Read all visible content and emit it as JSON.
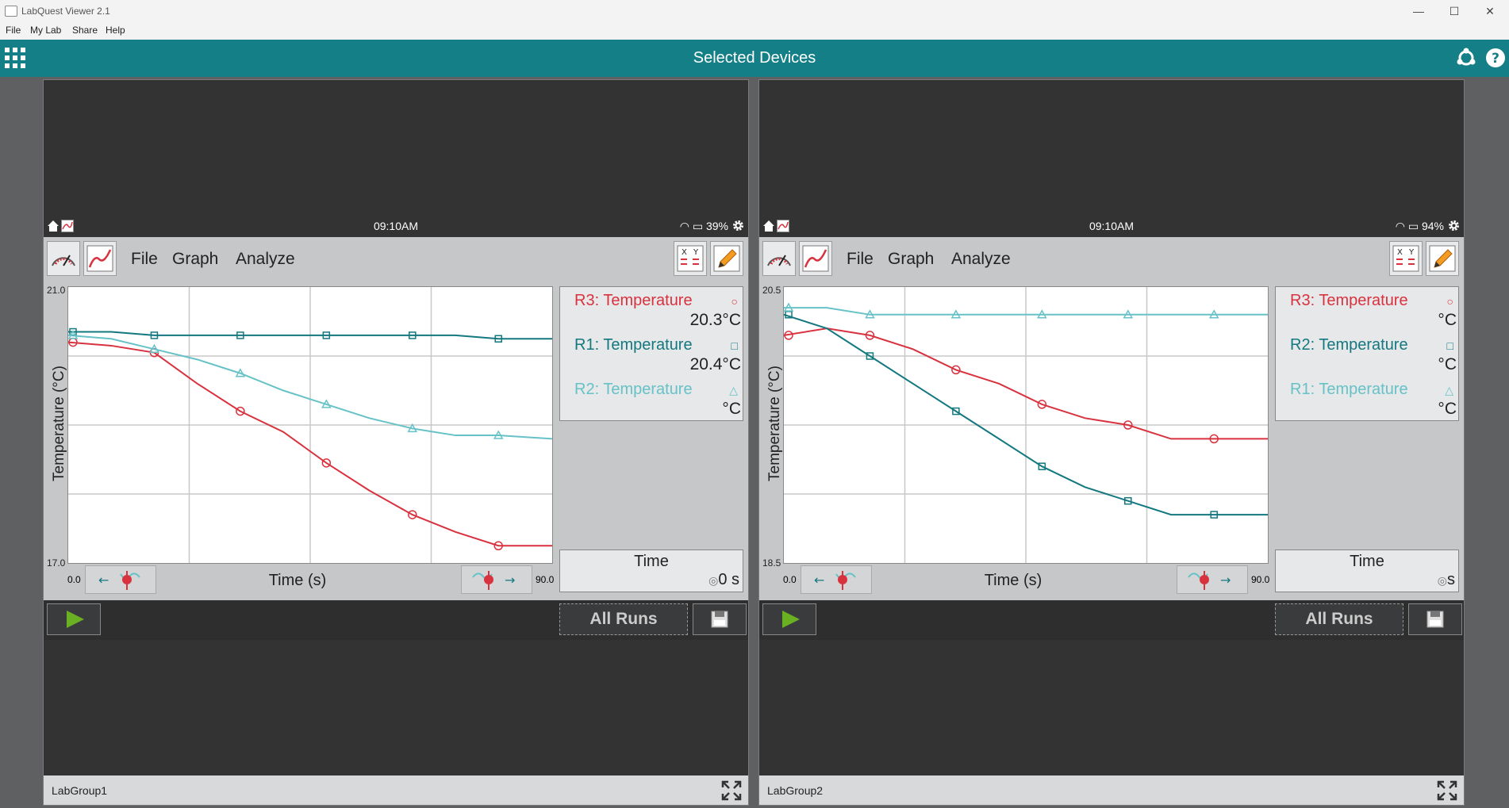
{
  "window": {
    "title": "LabQuest Viewer 2.1"
  },
  "menubar": [
    "File",
    "My Lab",
    "Share",
    "Help"
  ],
  "header": {
    "title": "Selected Devices"
  },
  "panels": [
    {
      "group_name": "LabGroup1",
      "time": "09:10AM",
      "battery": "39%",
      "menus": [
        "File",
        "Graph",
        "Analyze"
      ],
      "y_axis_label": "Temperature (°C)",
      "y_max": "21.0",
      "y_min": "17.0",
      "x_axis_label": "Time (s)",
      "x_min": "0.0",
      "x_max": "90.0",
      "legend": [
        {
          "name": "R3: Temperature",
          "value": "20.3°C",
          "marker": "○",
          "color": "#d9323f"
        },
        {
          "name": "R1: Temperature",
          "value": "20.4°C",
          "marker": "□",
          "color": "#13787f"
        },
        {
          "name": "R2: Temperature",
          "value": "°C",
          "marker": "△",
          "color": "#66c2c7"
        }
      ],
      "time_label": "Time",
      "time_value": "0 s",
      "all_runs": "All Runs"
    },
    {
      "group_name": "LabGroup2",
      "time": "09:10AM",
      "battery": "94%",
      "menus": [
        "File",
        "Graph",
        "Analyze"
      ],
      "y_axis_label": "Temperature (°C)",
      "y_max": "20.5",
      "y_min": "18.5",
      "x_axis_label": "Time (s)",
      "x_min": "0.0",
      "x_max": "90.0",
      "legend": [
        {
          "name": "R3: Temperature",
          "value": "°C",
          "marker": "○",
          "color": "#d9323f"
        },
        {
          "name": "R2: Temperature",
          "value": "°C",
          "marker": "□",
          "color": "#13787f"
        },
        {
          "name": "R1: Temperature",
          "value": "°C",
          "marker": "△",
          "color": "#66c2c7"
        }
      ],
      "time_label": "Time",
      "time_value": "s",
      "all_runs": "All Runs"
    }
  ],
  "chart_data": [
    {
      "type": "line",
      "xlabel": "Time (s)",
      "ylabel": "Temperature (°C)",
      "xlim": [
        0,
        90
      ],
      "ylim": [
        17.0,
        21.0
      ],
      "series": [
        {
          "name": "R3: Temperature",
          "color": "#d9323f",
          "x": [
            0,
            8,
            16,
            24,
            32,
            40,
            48,
            56,
            64,
            72,
            80,
            90
          ],
          "y": [
            20.2,
            20.15,
            20.05,
            19.6,
            19.2,
            18.9,
            18.45,
            18.05,
            17.7,
            17.45,
            17.25,
            17.25
          ]
        },
        {
          "name": "R1: Temperature",
          "color": "#13787f",
          "x": [
            0,
            8,
            16,
            24,
            32,
            40,
            48,
            56,
            64,
            72,
            80,
            90
          ],
          "y": [
            20.35,
            20.35,
            20.3,
            20.3,
            20.3,
            20.3,
            20.3,
            20.3,
            20.3,
            20.3,
            20.25,
            20.25
          ]
        },
        {
          "name": "R2: Temperature",
          "color": "#66c2c7",
          "x": [
            0,
            8,
            16,
            24,
            32,
            40,
            48,
            56,
            64,
            72,
            80,
            90
          ],
          "y": [
            20.3,
            20.25,
            20.1,
            19.95,
            19.75,
            19.5,
            19.3,
            19.1,
            18.95,
            18.85,
            18.85,
            18.8
          ]
        }
      ]
    },
    {
      "type": "line",
      "xlabel": "Time (s)",
      "ylabel": "Temperature (°C)",
      "xlim": [
        0,
        90
      ],
      "ylim": [
        18.5,
        20.5
      ],
      "series": [
        {
          "name": "R3: Temperature",
          "color": "#d9323f",
          "x": [
            0,
            8,
            16,
            24,
            32,
            40,
            48,
            56,
            64,
            72,
            80,
            90
          ],
          "y": [
            20.15,
            20.2,
            20.15,
            20.05,
            19.9,
            19.8,
            19.65,
            19.55,
            19.5,
            19.4,
            19.4,
            19.4
          ]
        },
        {
          "name": "R2: Temperature",
          "color": "#13787f",
          "x": [
            0,
            8,
            16,
            24,
            32,
            40,
            48,
            56,
            64,
            72,
            80,
            90
          ],
          "y": [
            20.3,
            20.2,
            20.0,
            19.8,
            19.6,
            19.4,
            19.2,
            19.05,
            18.95,
            18.85,
            18.85,
            18.85
          ]
        },
        {
          "name": "R1: Temperature",
          "color": "#66c2c7",
          "x": [
            0,
            8,
            16,
            24,
            32,
            40,
            48,
            56,
            64,
            72,
            80,
            90
          ],
          "y": [
            20.35,
            20.35,
            20.3,
            20.3,
            20.3,
            20.3,
            20.3,
            20.3,
            20.3,
            20.3,
            20.3,
            20.3
          ]
        }
      ]
    }
  ]
}
